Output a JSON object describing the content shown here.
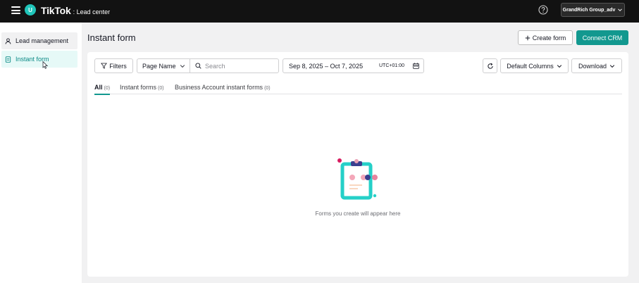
{
  "topbar": {
    "avatar_letter": "U",
    "brand": "TikTok",
    "product": ": Lead center",
    "account": "GrandRich Group_adv"
  },
  "sidebar": {
    "items": [
      {
        "label": "Lead management",
        "icon": "person-icon"
      },
      {
        "label": "Instant form",
        "icon": "form-icon",
        "active": true
      }
    ]
  },
  "header": {
    "title": "Instant form",
    "create_label": "Create form",
    "crm_label": "Connect CRM"
  },
  "toolbar": {
    "filters_label": "Filters",
    "page_select_value": "Page Name",
    "search_placeholder": "Search",
    "date_range": "Sep 8, 2025 – Oct 7, 2025",
    "timezone": "UTC+01:00",
    "columns_label": "Default Columns",
    "download_label": "Download"
  },
  "tabs": [
    {
      "label": "All",
      "count": "(0)",
      "active": true
    },
    {
      "label": "Instant forms",
      "count": "(0)"
    },
    {
      "label": "Business Account instant forms",
      "count": "(0)"
    }
  ],
  "empty_state": {
    "message": "Forms you create will appear here"
  },
  "colors": {
    "accent": "#12988f",
    "topbar": "#121212",
    "active_nav_bg": "#e6f9f7",
    "illustration_teal": "#25d0c8",
    "illustration_pink": "#e8547a"
  }
}
